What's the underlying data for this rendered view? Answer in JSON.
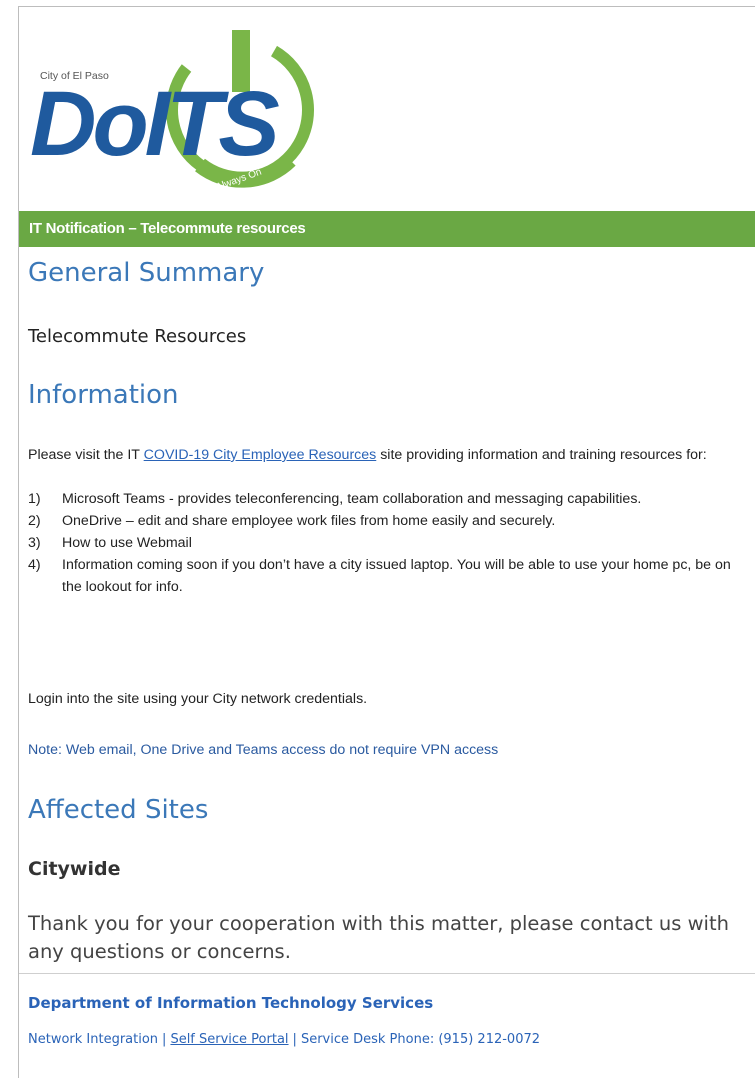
{
  "logo": {
    "city": "City of El Paso",
    "wordmark": "DoITS",
    "tagline": "Always On"
  },
  "banner": {
    "title": "IT Notification – Telecommute resources"
  },
  "general_summary": {
    "heading": "General Summary",
    "text": "Telecommute Resources"
  },
  "information": {
    "heading": "Information",
    "intro_prefix": "Please visit the IT ",
    "intro_link": "COVID-19 City Employee Resources",
    "intro_suffix": " site providing information and training resources for:",
    "items": [
      {
        "num": "1)",
        "text": "Microsoft Teams -  provides teleconferencing, team collaboration and messaging capabilities."
      },
      {
        "num": "2)",
        "text": "OneDrive – edit and share employee work files from home easily and securely."
      },
      {
        "num": "3)",
        "text": "How to use Webmail"
      },
      {
        "num": "4)",
        "text": "Information coming soon if you don’t have a city issued laptop.  You will be able to use your home pc, be on the lookout for info."
      }
    ],
    "login": "Login into the site using your City network credentials.",
    "note": "Note: Web email, One Drive and Teams access do not require VPN access"
  },
  "affected_sites": {
    "heading": "Affected Sites",
    "value": "Citywide"
  },
  "thanks": "Thank you for your cooperation with this matter, please contact us with any questions or concerns.",
  "footer": {
    "department": "Department of Information Technology Services",
    "link1": "Network Integration",
    "sep": "|",
    "link2": "Self Service Portal",
    "link3": "Service Desk Phone: (915) 212-0072"
  },
  "colors": {
    "banner": "#6aa844",
    "heading": "#3b78b8",
    "logo_blue": "#1f5a9e",
    "logo_green": "#7ab648"
  }
}
